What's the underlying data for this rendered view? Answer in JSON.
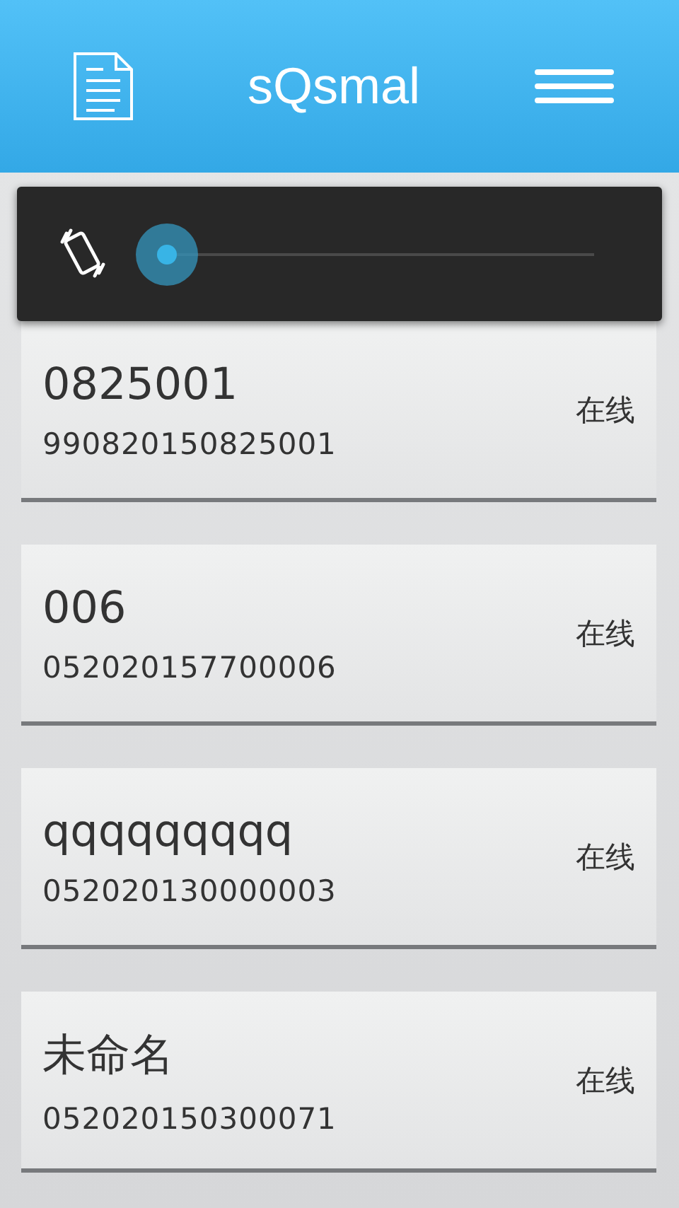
{
  "header": {
    "title": "sQsmal"
  },
  "devices": [
    {
      "name": "0825001",
      "id": "990820150825001",
      "status": "在线"
    },
    {
      "name": "006",
      "id": "052020157700006",
      "status": "在线"
    },
    {
      "name": "qqqqqqqqq",
      "id": "052020130000003",
      "status": "在线"
    },
    {
      "name": "未命名",
      "id": "052020150300071",
      "status": "在线"
    }
  ]
}
